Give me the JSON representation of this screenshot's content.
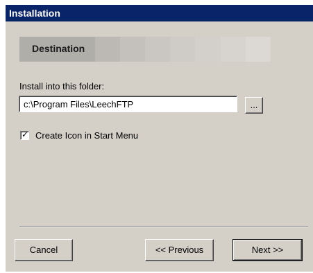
{
  "window": {
    "title": "Installation"
  },
  "step": {
    "label": "Destination",
    "gradient_colors": [
      "#b0aea9",
      "#bcb9b4",
      "#c4c1bc",
      "#cac7c2",
      "#cfccc7",
      "#d3d0cb",
      "#d7d4cf",
      "#dcd9d4"
    ]
  },
  "destination": {
    "folder_label": "Install into this folder:",
    "path_value": "c:\\Program Files\\LeechFTP",
    "browse_label": "..."
  },
  "options": {
    "create_icon_label": "Create Icon in Start Menu",
    "create_icon_checked": true,
    "check_glyph": "✓"
  },
  "buttons": {
    "cancel": "Cancel",
    "previous": "<< Previous",
    "next": "Next >>"
  },
  "colors": {
    "titlebar": "#0a246a",
    "dialog_face": "#d4d0c8"
  }
}
